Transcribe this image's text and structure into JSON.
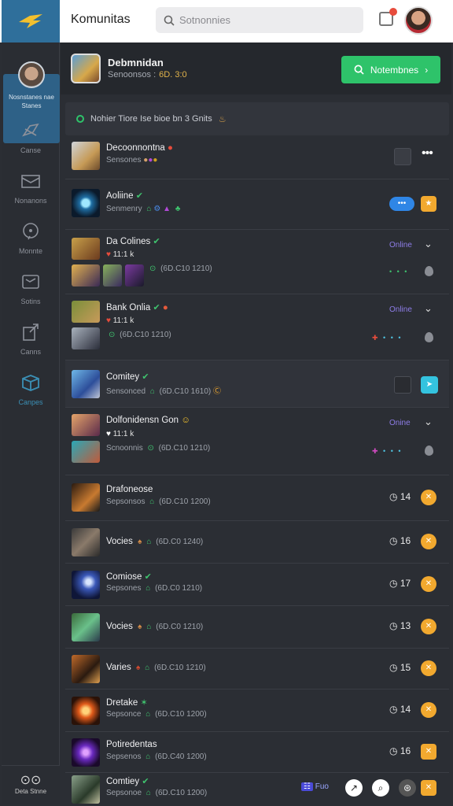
{
  "app": {
    "title": "Komunitas"
  },
  "search": {
    "placeholder": "Sotnonnies"
  },
  "sidebar": {
    "user_label_1": "Nosnstanes nae",
    "user_label_2": "Stanes",
    "items": [
      {
        "label": "Canse"
      },
      {
        "label": "Nonanons"
      },
      {
        "label": "Monnte"
      },
      {
        "label": "Sotins"
      },
      {
        "label": "Canns"
      },
      {
        "label": "Canpes"
      }
    ],
    "bottom_label": "Deta Stnne"
  },
  "header": {
    "title": "Debmnidan",
    "subtitle": "Senoonsos :",
    "subtitle_tag": "6D. 3:0",
    "primary_button": "Notembnes"
  },
  "notice": {
    "text": "Nohier Tiore Ise bioe bn 3 Gnits"
  },
  "rows": [
    {
      "name": "Decoonnontna",
      "sub": "Sensones"
    },
    {
      "name": "Aoliine",
      "sub": "Senmenry"
    },
    {
      "name": "Da Colines",
      "line2": "11:1 k",
      "sub": "(6D.C10 1210)",
      "status": "Online"
    },
    {
      "name": "Bank Onlia",
      "line2": "11:1 k",
      "sub": "(6D.C10 1210)",
      "status": "Online"
    },
    {
      "name": "Comitey",
      "sub": "(6D.C10 1610)"
    },
    {
      "name": "Dolfonidensn Gon",
      "line2": "11:1 k",
      "sub": "Scnoonnis",
      "sub2": "(6D.C10 1210)",
      "status": "Onine"
    },
    {
      "name": "Drafoneose",
      "sub": "Sepsonsos",
      "sub2": "(6D.C10 1200)",
      "count": "14"
    },
    {
      "name": "Vocies",
      "sub": "(6D.C0 1240)",
      "count": "16"
    },
    {
      "name": "Comiose",
      "sub": "Sepsones",
      "sub2": "(6D.C0 1210)",
      "count": "17"
    },
    {
      "name": "Vocies",
      "sub": "(6D.C0 1210)",
      "count": "13"
    },
    {
      "name": "Varies",
      "sub": "(6D.C10 1210)",
      "count": "15"
    },
    {
      "name": "Dretake",
      "sub": "Sepsonce",
      "sub2": "(6D.C10 1200)",
      "count": "14"
    },
    {
      "name": "Potiredentas",
      "sub": "Sepsenos",
      "sub2": "(6D.C40 1200)",
      "count": "16"
    },
    {
      "name": "Comtiey",
      "sub": "Sepsonoe",
      "sub2": "(6D.C10 1200)",
      "tag": "Fuo"
    }
  ],
  "colors": {
    "accent": "#2ec36a",
    "sidebar_active": "#2e6187",
    "online": "#8e7de8",
    "badge": "#f2a92f"
  }
}
